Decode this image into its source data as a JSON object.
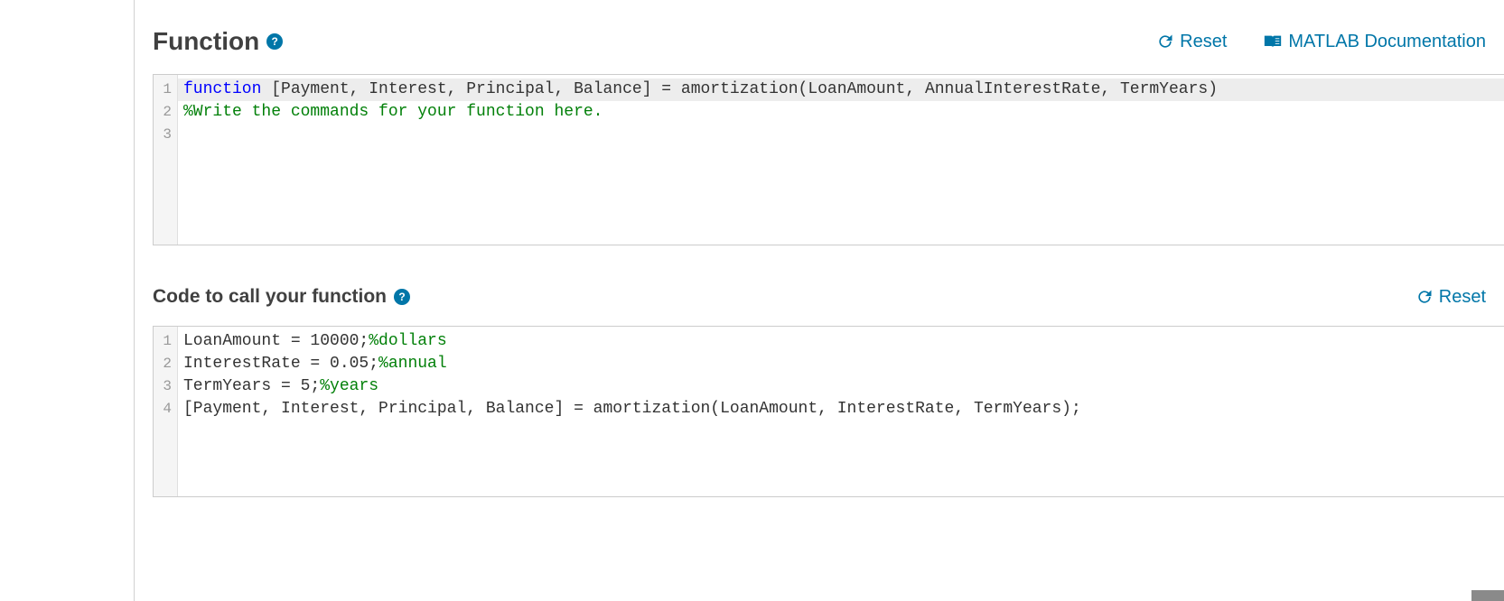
{
  "function_section": {
    "title": "Function",
    "help": "?",
    "actions": {
      "reset": "Reset",
      "docs": "MATLAB Documentation"
    },
    "editor": {
      "line_numbers": [
        "1",
        "2",
        "3"
      ],
      "line1": {
        "kw": "function",
        "rest": " [Payment, Interest, Principal, Balance] = amortization(LoanAmount, AnnualInterestRate, TermYears)"
      },
      "line2_comment": "%Write the commands for your function here.",
      "line3": ""
    }
  },
  "caller_section": {
    "title": "Code to call your function",
    "help": "?",
    "actions": {
      "reset": "Reset"
    },
    "editor": {
      "line_numbers": [
        "1",
        "2",
        "3",
        "4"
      ],
      "line1": {
        "code": "LoanAmount = 10000;",
        "comment": "%dollars"
      },
      "line2": {
        "code": "InterestRate = 0.05;",
        "comment": "%annual"
      },
      "line3": {
        "code": "TermYears = 5;",
        "comment": "%years"
      },
      "line4": {
        "code": "[Payment, Interest, Principal, Balance] = amortization(LoanAmount, InterestRate, TermYears);"
      }
    }
  }
}
